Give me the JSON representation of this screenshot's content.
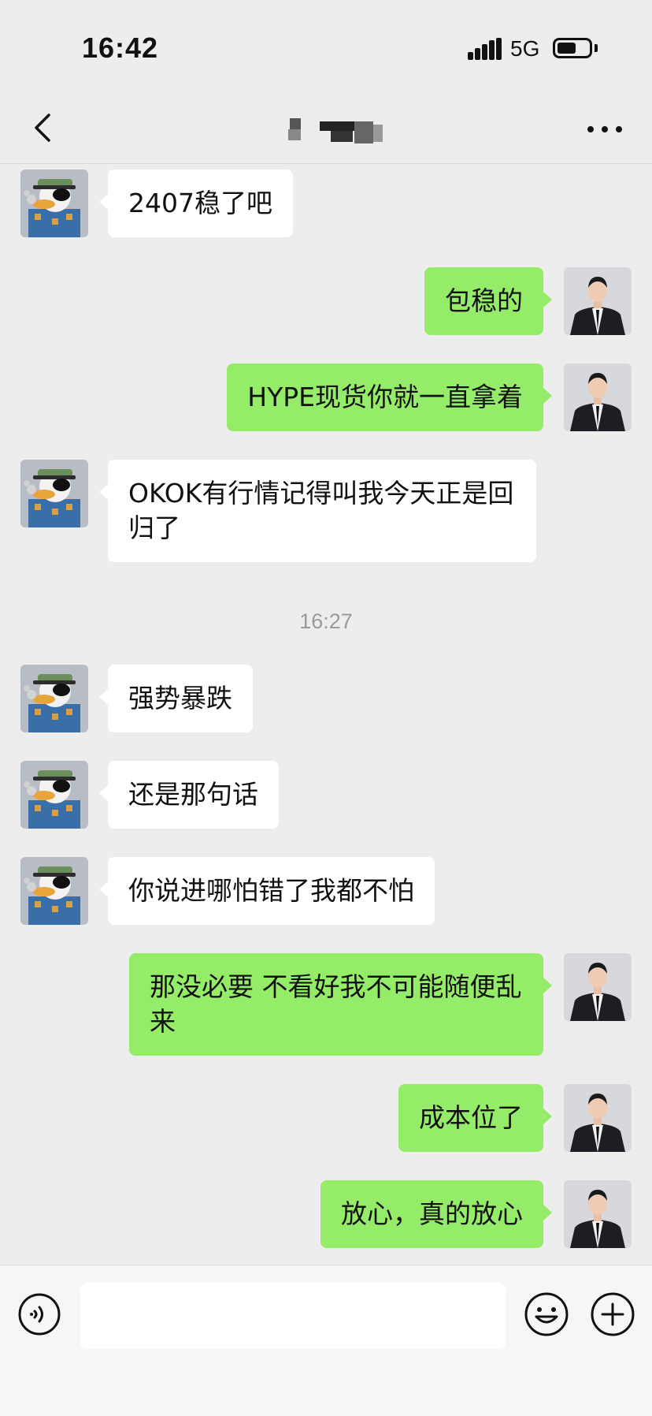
{
  "status_bar": {
    "time": "16:42",
    "network": "5G",
    "battery_level": 0.6
  },
  "nav": {
    "back_icon": "chevron-left-icon",
    "more_icon": "more-icon"
  },
  "messages": [
    {
      "side": "left",
      "text": "2407稳了吧"
    },
    {
      "side": "right",
      "text": "包稳的"
    },
    {
      "side": "right",
      "text": "HYPE现货你就一直拿着"
    },
    {
      "side": "left",
      "text": "OKOK有行情记得叫我今天正是回归了"
    },
    {
      "time": "16:27"
    },
    {
      "side": "left",
      "text": "强势暴跌"
    },
    {
      "side": "left",
      "text": "还是那句话"
    },
    {
      "side": "left",
      "text": "你说进哪怕错了我都不怕"
    },
    {
      "side": "right",
      "text": "那没必要 不看好我不可能随便乱来"
    },
    {
      "side": "right",
      "text": "成本位了"
    },
    {
      "side": "right",
      "text": "放心，真的放心"
    }
  ],
  "input_bar": {
    "voice_icon": "voice-icon",
    "input_value": "",
    "emoji_icon": "emoji-icon",
    "plus_icon": "plus-icon"
  },
  "colors": {
    "background": "#ededed",
    "self_bubble": "#95ec69",
    "other_bubble": "#ffffff"
  }
}
